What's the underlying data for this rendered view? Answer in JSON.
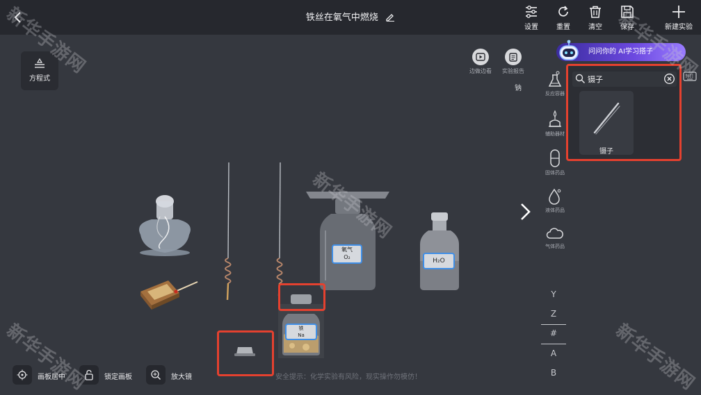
{
  "header": {
    "title": "铁丝在氧气中燃烧"
  },
  "toolbar": [
    {
      "label": "设置",
      "icon": "sliders-icon"
    },
    {
      "label": "重置",
      "icon": "refresh-icon"
    },
    {
      "label": "清空",
      "icon": "trash-icon"
    },
    {
      "label": "保存",
      "icon": "save-icon"
    },
    {
      "label": "新建实验",
      "icon": "plus-icon"
    }
  ],
  "left_panel": {
    "equation_label": "方程式"
  },
  "top_right_tools": [
    {
      "label": "边做边看",
      "icon": "play-icon"
    },
    {
      "label": "实验报告",
      "icon": "report-icon"
    }
  ],
  "element_label": "钠",
  "ai_banner": {
    "text": "问问你的 AI学习搭子"
  },
  "search": {
    "query": "镊子",
    "results": [
      {
        "label": "镊子",
        "icon": "tweezers-icon"
      }
    ]
  },
  "categories": [
    {
      "label": "反应容器",
      "icon": "flask-icon"
    },
    {
      "label": "辅助器材",
      "icon": "burner-icon"
    },
    {
      "label": "固体药品",
      "icon": "capsule-icon"
    },
    {
      "label": "液体药品",
      "icon": "drop-icon"
    },
    {
      "label": "气体药品",
      "icon": "cloud-icon"
    }
  ],
  "alpha_index": [
    "Y",
    "Z",
    "#",
    "A",
    "B"
  ],
  "bottom_bar": [
    {
      "label": "画板居中",
      "icon": "target-icon"
    },
    {
      "label": "锁定画板",
      "icon": "lock-icon"
    },
    {
      "label": "放大镜",
      "icon": "zoom-in-icon"
    }
  ],
  "safety_tip": "安全提示：化学实验有风险，现实操作勿模仿！",
  "labels": {
    "oxygen_name": "氧气",
    "oxygen_formula": "O₂",
    "water_formula": "H₂O",
    "iron_name": "铁",
    "sodium_formula": "Na"
  },
  "watermark": "新华手游网",
  "colors": {
    "highlight": "#e5412f",
    "ai_gradient_start": "#3b2c9e",
    "ai_gradient_end": "#9a7cff"
  }
}
